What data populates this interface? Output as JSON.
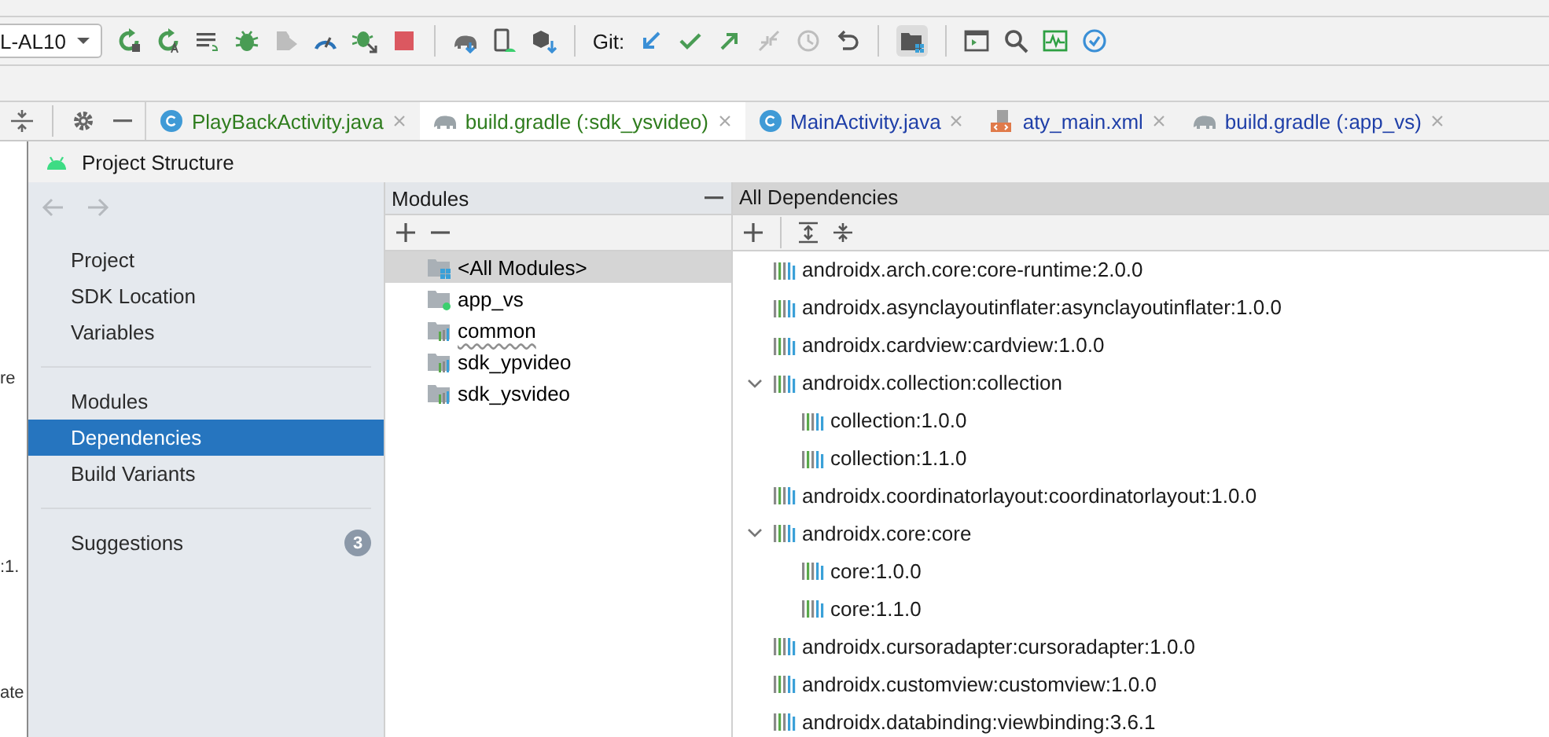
{
  "toolbar": {
    "device_dropdown": "L-AL10",
    "git_label": "Git:"
  },
  "background_fragments": [
    "re",
    ":1.",
    "ate"
  ],
  "editor_tabs": [
    {
      "label": "PlayBackActivity.java",
      "kind": "java",
      "color": "#2f7d1e",
      "selected": false
    },
    {
      "label": "build.gradle (:sdk_ysvideo)",
      "kind": "gradle",
      "color": "#2f7d1e",
      "selected": true
    },
    {
      "label": "MainActivity.java",
      "kind": "java",
      "color": "#1f3fa8",
      "selected": false
    },
    {
      "label": "aty_main.xml",
      "kind": "xml",
      "color": "#1f3fa8",
      "selected": false
    },
    {
      "label": "build.gradle (:app_vs)",
      "kind": "gradle",
      "color": "#1f3fa8",
      "selected": false
    }
  ],
  "dialog": {
    "title": "Project Structure",
    "nav_sections": [
      [
        {
          "label": "Project",
          "selected": false
        },
        {
          "label": "SDK Location",
          "selected": false
        },
        {
          "label": "Variables",
          "selected": false
        }
      ],
      [
        {
          "label": "Modules",
          "selected": false
        },
        {
          "label": "Dependencies",
          "selected": true
        },
        {
          "label": "Build Variants",
          "selected": false
        }
      ],
      [
        {
          "label": "Suggestions",
          "selected": false,
          "badge": "3"
        }
      ]
    ],
    "modules": {
      "title": "Modules",
      "items": [
        {
          "label": "<All Modules>",
          "kind": "all",
          "selected": true,
          "typo": false
        },
        {
          "label": "app_vs",
          "kind": "app",
          "selected": false,
          "typo": false
        },
        {
          "label": "common",
          "kind": "library",
          "selected": false,
          "typo": true
        },
        {
          "label": "sdk_ypvideo",
          "kind": "library",
          "selected": false,
          "typo": false
        },
        {
          "label": "sdk_ysvideo",
          "kind": "library",
          "selected": false,
          "typo": false
        }
      ]
    },
    "dependencies": {
      "title": "All Dependencies",
      "items": [
        {
          "label": "androidx.arch.core:core-runtime:2.0.0"
        },
        {
          "label": "androidx.asynclayoutinflater:asynclayoutinflater:1.0.0"
        },
        {
          "label": "androidx.cardview:cardview:1.0.0"
        },
        {
          "label": "androidx.collection:collection",
          "expanded": true,
          "children": [
            {
              "label": "collection:1.0.0"
            },
            {
              "label": "collection:1.1.0"
            }
          ]
        },
        {
          "label": "androidx.coordinatorlayout:coordinatorlayout:1.0.0"
        },
        {
          "label": "androidx.core:core",
          "expanded": true,
          "children": [
            {
              "label": "core:1.0.0"
            },
            {
              "label": "core:1.1.0"
            }
          ]
        },
        {
          "label": "androidx.cursoradapter:cursoradapter:1.0.0"
        },
        {
          "label": "androidx.customview:customview:1.0.0"
        },
        {
          "label": "androidx.databinding:viewbinding:3.6.1"
        }
      ]
    }
  }
}
